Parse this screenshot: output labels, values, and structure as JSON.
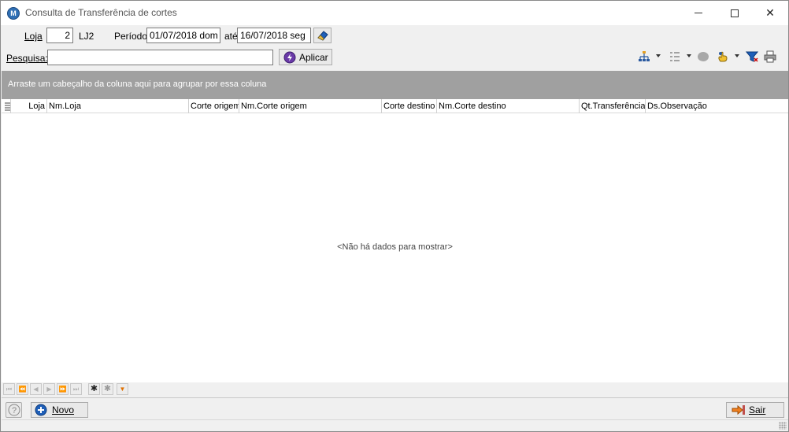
{
  "window": {
    "title": "Consulta de Transferência de cortes",
    "icon": "app-logo-icon",
    "close_glyph": "✕"
  },
  "filters": {
    "loja_label": "Loja",
    "loja_value": "2",
    "loja_name": "LJ2",
    "periodo_label": "Período",
    "periodo_start": "01/07/2018 dom",
    "ate_label": "até",
    "periodo_end": "16/07/2018 seg",
    "pesquisa_label": "Pesquisa:",
    "pesquisa_value": "",
    "aplicar_label": "Aplicar"
  },
  "toolbar_icons": [
    "hierarchy-icon",
    "list-icon",
    "circle-icon",
    "hand-icon",
    "filter-icon",
    "printer-icon"
  ],
  "group_panel": {
    "text": "Arraste um cabeçalho da coluna aqui para agrupar por essa coluna"
  },
  "grid": {
    "columns": [
      {
        "label": "Loja"
      },
      {
        "label": "Nm.Loja"
      },
      {
        "label": "Corte origem"
      },
      {
        "label": "Nm.Corte origem"
      },
      {
        "label": "Corte destino"
      },
      {
        "label": "Nm.Corte destino"
      },
      {
        "label": "Qt.Transferência"
      },
      {
        "label": "Ds.Observação"
      }
    ],
    "rows": [],
    "empty_text": "<Não há dados para mostrar>"
  },
  "footer": {
    "novo_label": "Novo",
    "sair_label": "Sair"
  },
  "colors": {
    "group_panel_bg": "#a0a0a0",
    "accent_blue": "#1f5fb8"
  }
}
